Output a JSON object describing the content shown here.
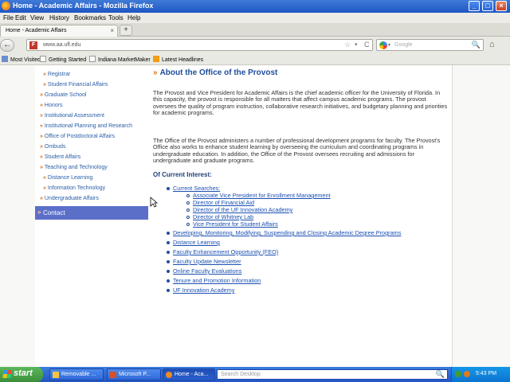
{
  "window": {
    "title": "Home - Academic Affairs - Mozilla Firefox",
    "controls": {
      "minimize": "_",
      "maximize": "□",
      "close": "×"
    }
  },
  "menu": [
    "File",
    "Edit",
    "View",
    "History",
    "Bookmarks",
    "Tools",
    "Help"
  ],
  "tabs": [
    {
      "label": "Home - Academic Affairs",
      "close": "×"
    }
  ],
  "newtab_label": "+",
  "navbar": {
    "back": "←",
    "favicon": "F",
    "url": "www.aa.ufl.edu",
    "star": "☆",
    "dropdown": "▾",
    "reload": "C",
    "search_placeholder": "Google",
    "search_dropdown": "▾",
    "search_icon": "🔍",
    "home": "⌂"
  },
  "bookmarks": [
    {
      "label": "Most Visited"
    },
    {
      "label": "Getting Started"
    },
    {
      "label": "Indiana MarketMaker"
    },
    {
      "label": "Latest Headlines"
    }
  ],
  "leftnav": {
    "items": [
      {
        "label": "Registrar",
        "indent": true
      },
      {
        "label": "Student Financial Affairs",
        "indent": true
      },
      {
        "label": "Graduate School",
        "indent": false
      },
      {
        "label": "Honors",
        "indent": false
      },
      {
        "label": "Institutional Assessment",
        "indent": false
      },
      {
        "label": "Institutional Planning and Research",
        "indent": false
      },
      {
        "label": "Office of Postdoctoral Affairs",
        "indent": false
      },
      {
        "label": "Ombuds",
        "indent": false
      },
      {
        "label": "Student Affairs",
        "indent": false
      },
      {
        "label": "Teaching and Technology",
        "indent": false
      },
      {
        "label": "Distance Learning",
        "indent": true
      },
      {
        "label": "Information Technology",
        "indent": true
      },
      {
        "label": "Undergraduate Affairs",
        "indent": false
      }
    ],
    "arrow": "»",
    "contact": "Contact"
  },
  "main": {
    "arrow": "»",
    "heading": "About the Office of the Provost",
    "para1": "The Provost and Vice President for Academic Affairs is the chief academic officer for the University of Florida. In this capacity, the provost is responsible for all matters that affect campus academic programs. The provost oversees the quality of program instruction, collaborative research initiatives, and budgetary planning and priorities for academic programs.",
    "para2": "The Office of the Provost administers a number of professional development programs for faculty. The Provost's Office also works to enhance student learning by overseeing the curriculum and coordinating programs in undergraduate education. In addition, the Office of the Provost oversees recruiting and admissions for undergraduate and graduate programs.",
    "subheading": "Of Current Interest:",
    "current_searches": {
      "label": "Current Searches:",
      "items": [
        "Associate Vice President for Enrollment Management",
        "Director of Financial Aid",
        "Director of the UF Innovation Academy",
        "Director of Whitney Lab",
        "Vice President for Student Affairs"
      ]
    },
    "links": [
      "Developing, Monitoring, Modifying, Suspending and Closing Academic Degree Programs",
      "Distance Learning",
      "Faculty Enhancement Opportunity (FEO)",
      "Faculty Update Newsletter",
      "Online Faculty Evaluations",
      "Tenure and Promotion Information",
      "UF Innovation Academy"
    ]
  },
  "taskbar": {
    "start": "start",
    "tasks": [
      {
        "label": "Removable ...",
        "icon_color": "#f5c542"
      },
      {
        "label": "Microsoft P...",
        "icon_color": "#d9502a"
      },
      {
        "label": "Home - Aca...",
        "icon_color": "#f08a24"
      }
    ],
    "search_placeholder": "Search Desktop",
    "time": "5:43 PM"
  }
}
